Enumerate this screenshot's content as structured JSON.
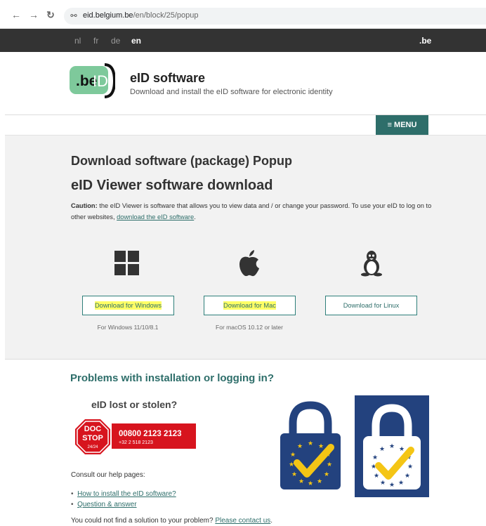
{
  "browser": {
    "url_host": "eid.belgium.be",
    "url_path": "/en/block/25/popup"
  },
  "languages": [
    "nl",
    "fr",
    "de",
    "en"
  ],
  "active_language": "en",
  "gov_mark": ".be",
  "header": {
    "logo_text_be": ".be",
    "logo_text_id": "ID",
    "title": "eID software",
    "subtitle": "Download and install the eID software for electronic identity",
    "menu_label": "≡ MENU"
  },
  "main": {
    "heading": "Download software (package) Popup",
    "subheading": "eID Viewer software download",
    "caution_label": "Caution:",
    "caution_text": " the eID Viewer is software that allows you to view data and / or change your password. To use your eID to log on to other websites, ",
    "caution_link": "download the eID software",
    "caution_end": ".",
    "downloads": [
      {
        "label": "Download for Windows",
        "note": "For Windows 11/10/8.1",
        "icon": "windows-icon",
        "highlighted": true
      },
      {
        "label": "Download for Mac",
        "note": "For macOS 10.12 or later",
        "icon": "apple-icon",
        "highlighted": true
      },
      {
        "label": "Download for Linux",
        "note": "",
        "icon": "linux-icon",
        "highlighted": false
      }
    ]
  },
  "help": {
    "problems_title": "Problems with installation or logging in?",
    "lost_title": "eID lost or stolen?",
    "docstop_word1": "DOC",
    "docstop_word2": "STOP",
    "docstop_hours": "24/24",
    "docstop_phone": "00800 2123 2123",
    "docstop_phone2": "+32 2 518 2123",
    "consult": "Consult our help pages:",
    "links": [
      "How to install the eID software?",
      "Question & answer"
    ],
    "bottom_text": "You could not find a solution to your problem? ",
    "bottom_link": "Please contact us",
    "bottom_end": "."
  },
  "colors": {
    "brand": "#2e6e6a",
    "highlight": "#ffff66",
    "eu_blue": "#23427e",
    "eu_yellow": "#f4c515",
    "docstop_red": "#d7141e"
  }
}
